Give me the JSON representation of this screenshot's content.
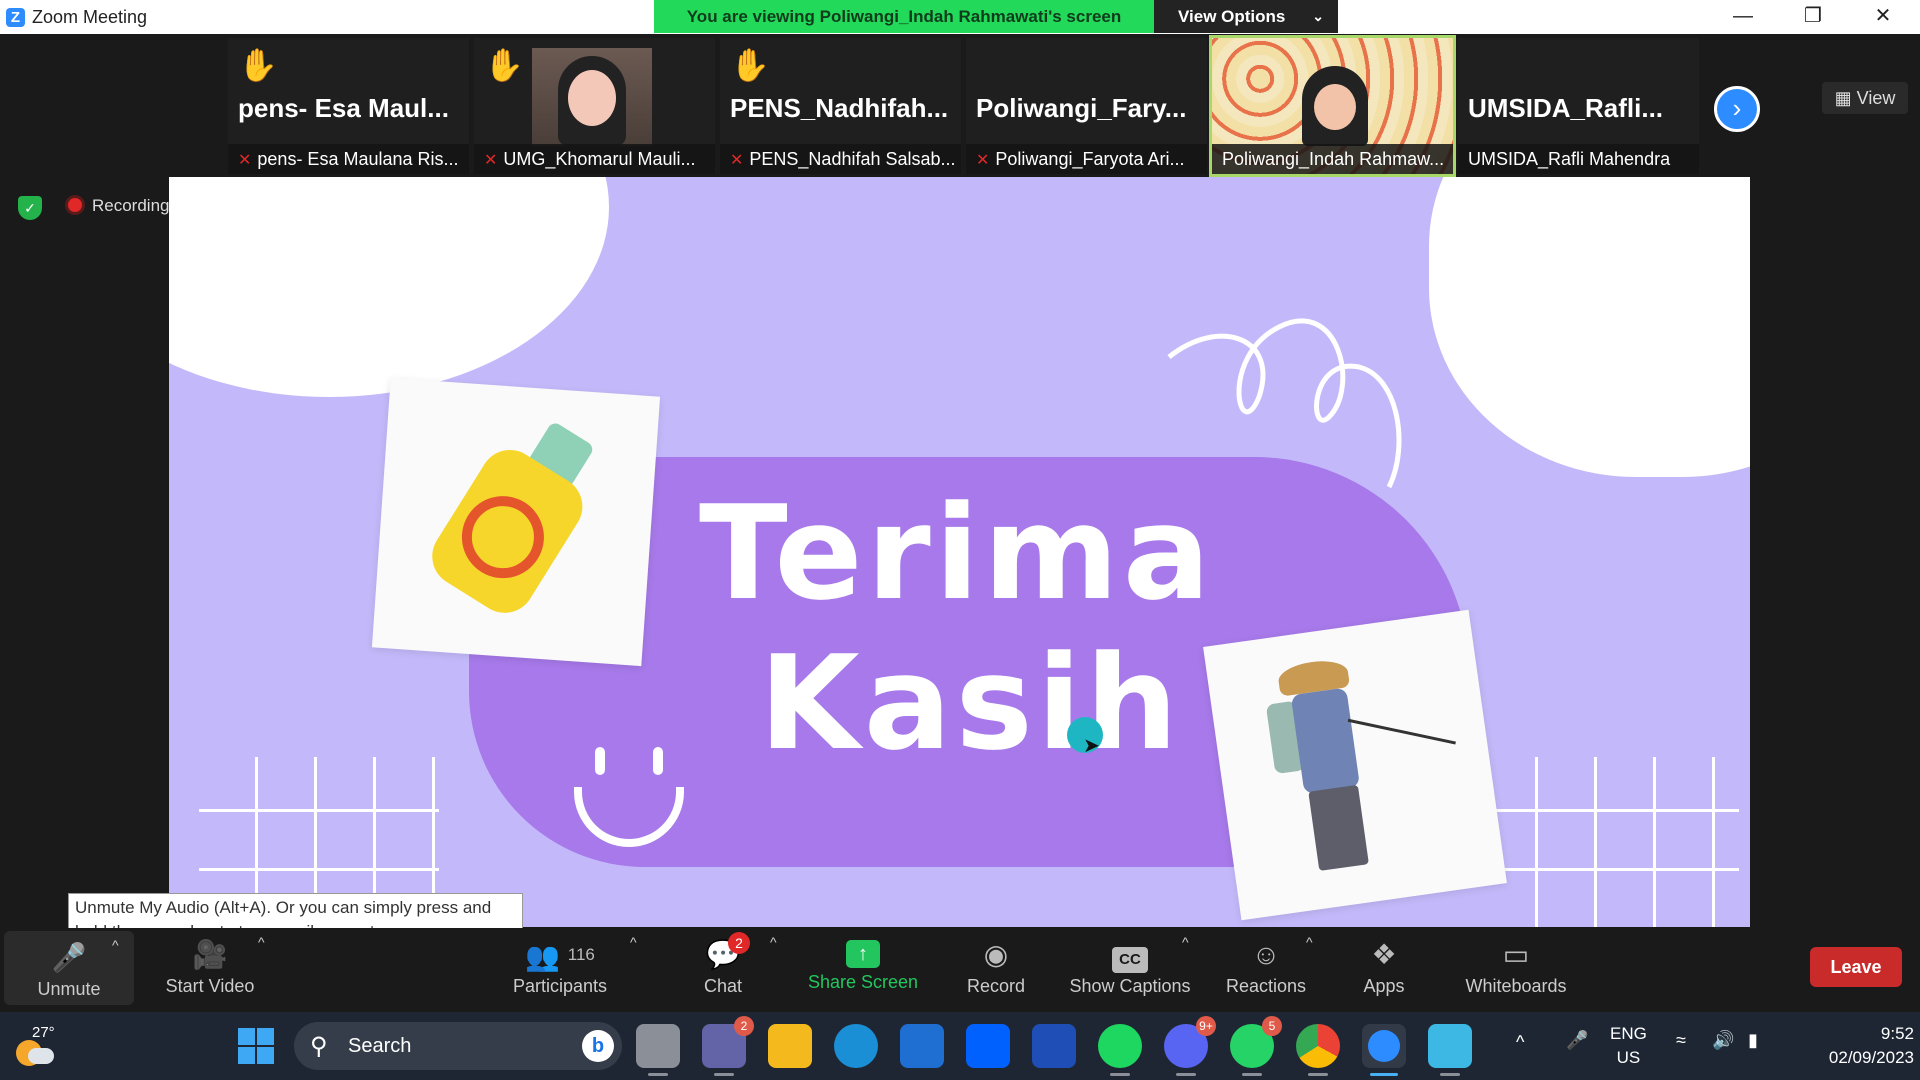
{
  "window": {
    "title": "Zoom Meeting",
    "viewing_banner": "You are viewing Poliwangi_Indah Rahmawati's screen",
    "view_options": "View Options"
  },
  "strip": {
    "tiles": [
      {
        "big_name": "pens- Esa Maul...",
        "name": "pens- Esa Maulana Ris...",
        "hand": true
      },
      {
        "big_name": "",
        "name": "UMG_Khomarul Mauli...",
        "hand": true,
        "video": true
      },
      {
        "big_name": "PENS_Nadhifah...",
        "name": "PENS_Nadhifah Salsab...",
        "hand": true
      },
      {
        "big_name": "Poliwangi_Fary...",
        "name": "Poliwangi_Faryota Ari...",
        "hand": false
      },
      {
        "big_name": "",
        "name": "Poliwangi_Indah Rahmaw...",
        "hand": false,
        "video": true,
        "active": true
      },
      {
        "big_name": "UMSIDA_Rafli...",
        "name": "UMSIDA_Rafli Mahendra",
        "hand": false
      }
    ],
    "view_label": "View"
  },
  "status": {
    "recording_label": "Recording"
  },
  "slide": {
    "line1": "Terima",
    "line2": "Kasih"
  },
  "tooltip": {
    "text": "Unmute My Audio (Alt+A). Or you can simply press and hold the space bar to temporarily unmute."
  },
  "toolbar": {
    "unmute": "Unmute",
    "start_video": "Start Video",
    "participants": "Participants",
    "participants_count": "116",
    "chat": "Chat",
    "chat_badge": "2",
    "share_screen": "Share Screen",
    "record": "Record",
    "show_captions": "Show Captions",
    "captions_icon": "CC",
    "reactions": "Reactions",
    "apps": "Apps",
    "whiteboards": "Whiteboards",
    "leave": "Leave"
  },
  "taskbar": {
    "temperature": "27°",
    "search_placeholder": "Search",
    "teams_badge": "2",
    "discord_badge": "9+",
    "whatsapp_badge": "5",
    "lang_top": "ENG",
    "lang_bottom": "US",
    "time": "9:52",
    "date": "02/09/2023"
  },
  "colors": {
    "zoom_blue": "#2d8cff",
    "banner_green": "#23d959",
    "leave_red": "#c92a2a",
    "slide_bg": "#c3b9fa",
    "slide_blob": "#a779ea"
  }
}
